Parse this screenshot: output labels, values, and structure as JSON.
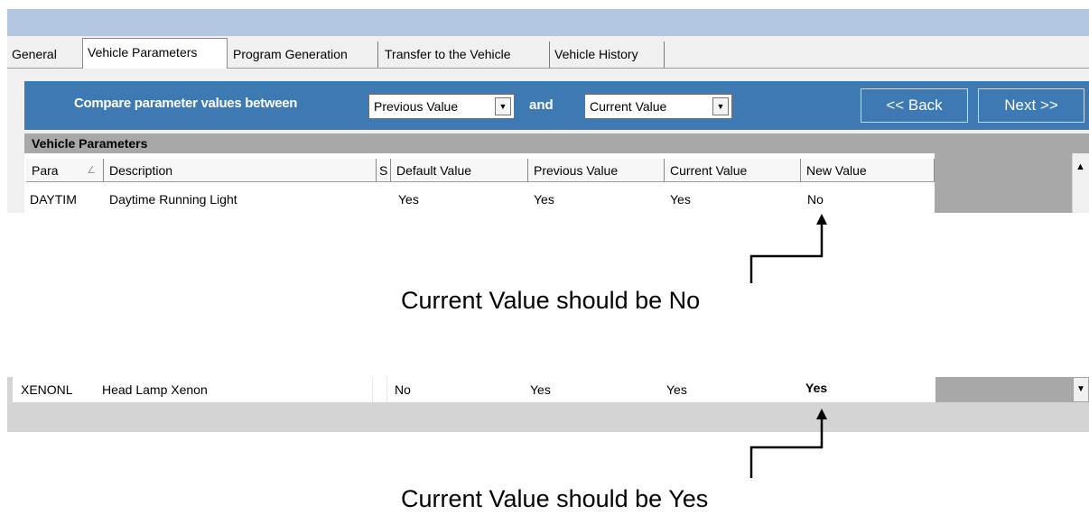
{
  "tabs": [
    "General",
    "Vehicle Parameters",
    "Program Generation",
    "Transfer to the Vehicle",
    "Vehicle History"
  ],
  "toolbar": {
    "compare_label": "Compare parameter values between",
    "select_left": "Previous Value",
    "and_label": "and",
    "select_right": "Current Value",
    "back_button": "<< Back",
    "next_button": "Next >>"
  },
  "section_title": "Vehicle Parameters",
  "columns": [
    "Para",
    "Description",
    "S",
    "Default Value",
    "Previous Value",
    "Current Value",
    "New Value"
  ],
  "rows": [
    [
      "DAYTIM",
      "Daytime Running Light",
      "",
      "Yes",
      "Yes",
      "Yes",
      "No"
    ],
    [
      "XENONL",
      "Head Lamp Xenon",
      "",
      "No",
      "Yes",
      "Yes",
      "Yes"
    ]
  ],
  "annotations": [
    "Current Value should be No",
    "Current Value should be Yes"
  ],
  "colors": {
    "band": "#3d7ab3",
    "title_strip": "#b4c7e1",
    "grid_gray": "#a8a8a8"
  },
  "icons": [
    "sort-icon",
    "dropdown-arrow-icon",
    "scroll-up-icon",
    "scroll-down-icon",
    "pointer-arrow-icon"
  ]
}
